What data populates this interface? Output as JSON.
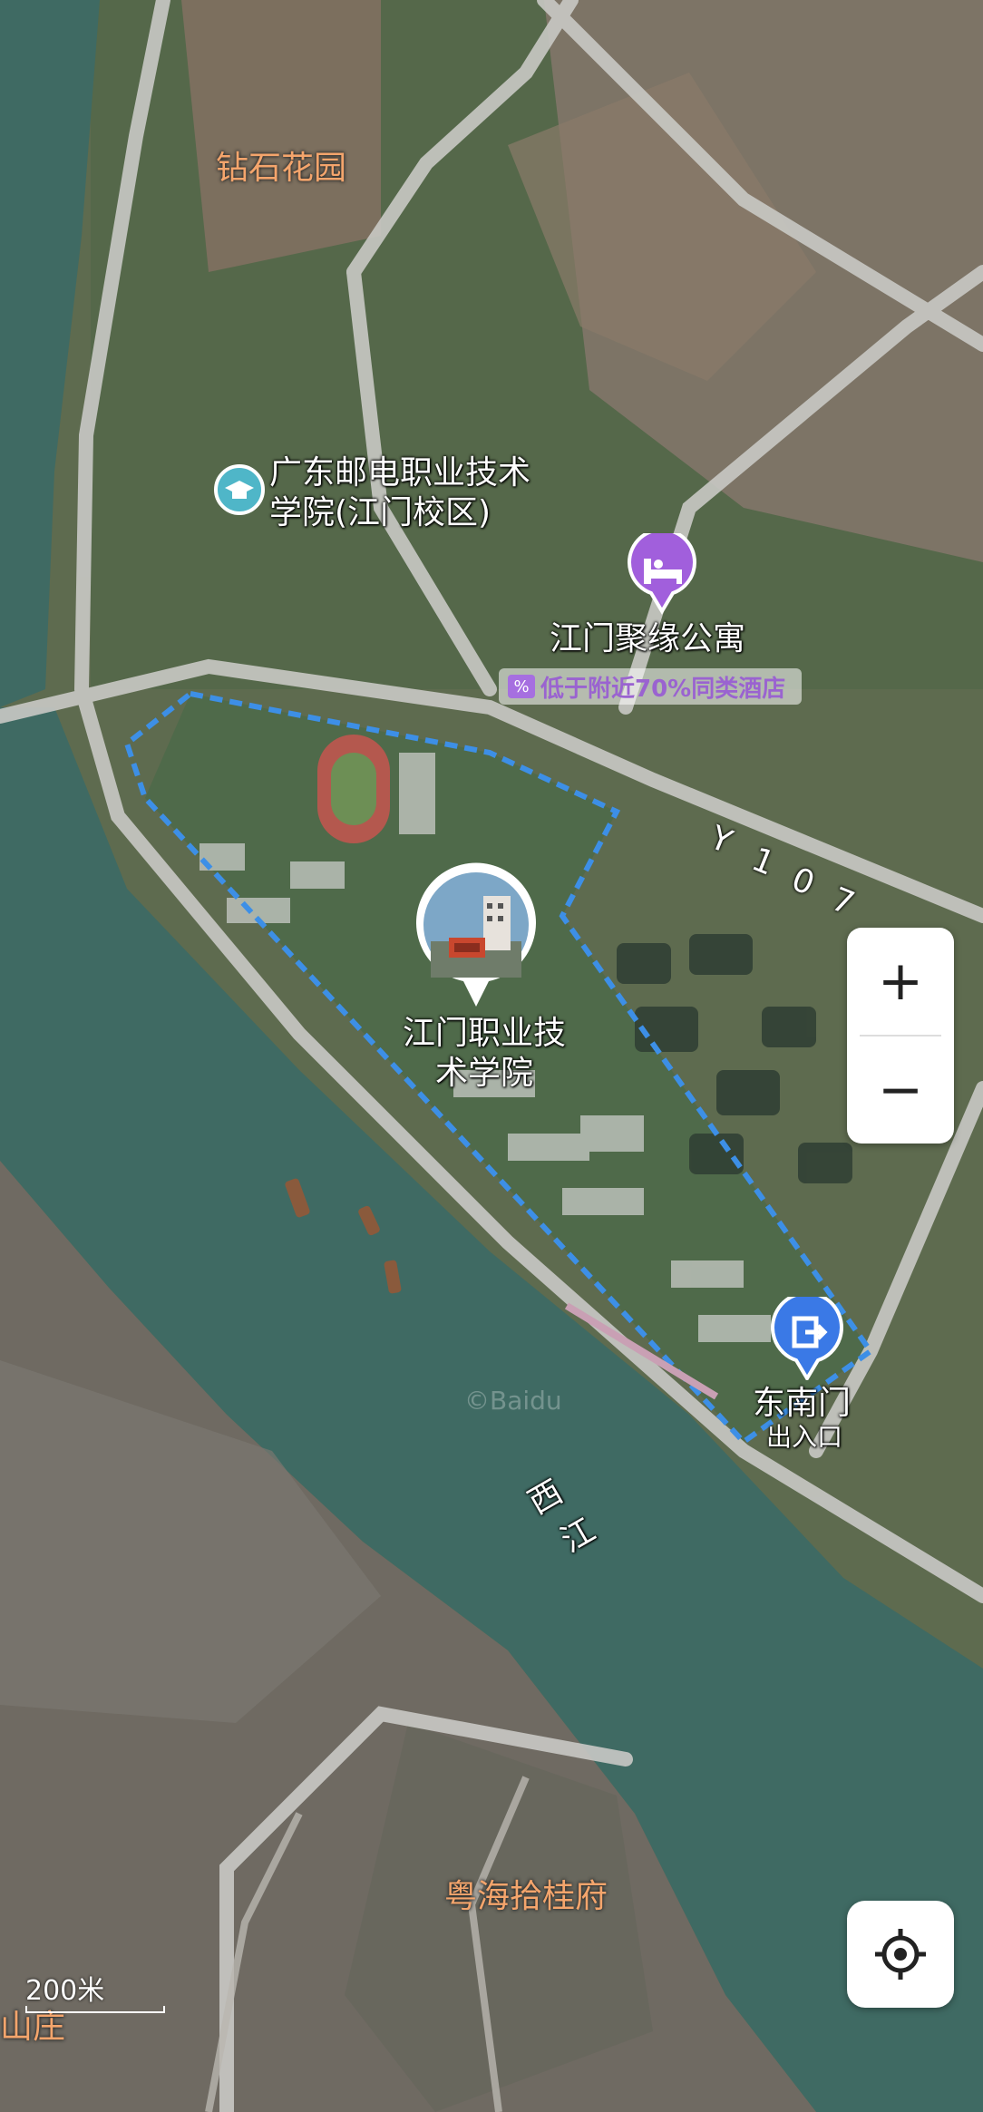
{
  "map": {
    "places": {
      "diamond_garden": "钻石花园",
      "poly_college": "广东邮电职业技术学院(江门校区)",
      "poly_college_line1": "广东邮电职业技术",
      "poly_college_line2": "学院(江门校区)",
      "apartment": "江门聚缘公寓",
      "apartment_promo": "低于附近70%同类酒店",
      "road_y107": [
        "Y",
        "1",
        "0",
        "7"
      ],
      "jiangmen_college_line1": "江门职业技",
      "jiangmen_college_line2": "术学院",
      "southeast_gate": "东南门",
      "southeast_gate_sub": "出入口",
      "xijiang_1": "西",
      "xijiang_2": "江",
      "yuehai": "粤海拾桂府",
      "shanzhuang": "山庄"
    },
    "controls": {
      "zoom_in": "+",
      "zoom_out": "−"
    },
    "scale": "200米",
    "watermark": "©Baidu",
    "colors": {
      "water": "#3f6a63",
      "boundary": "#3d8fe6",
      "school_icon": "#4fb6c8",
      "hotel_icon": "#a15fdc",
      "gate_icon": "#3a79e6",
      "orange_label": "#f4a56c"
    },
    "icons": {
      "school": "graduation-cap-icon",
      "hotel": "bed-icon",
      "gate": "exit-icon",
      "locate": "crosshair-icon"
    }
  }
}
